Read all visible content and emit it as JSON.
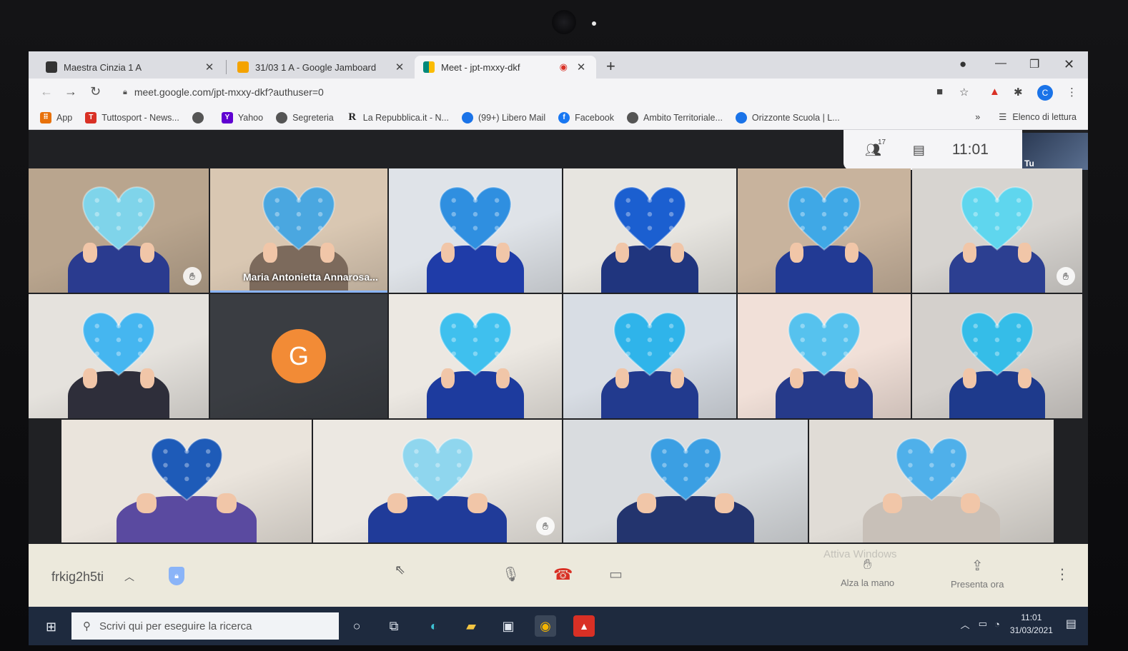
{
  "browser": {
    "tabs": [
      {
        "title": "Maestra Cinzia 1 A",
        "favicon_color": "#333333"
      },
      {
        "title": "31/03 1 A - Google Jamboard",
        "favicon_color": "#f4a300"
      },
      {
        "title": "Meet - jpt-mxxy-dkf",
        "favicon_color": "#00897b"
      }
    ],
    "new_tab": "+",
    "url": "meet.google.com/jpt-mxxy-dkf?authuser=0",
    "profile_initial": "C",
    "bookmarks": [
      {
        "label": "App",
        "icon": "apps-grid-icon",
        "color": "#e8710a"
      },
      {
        "label": "Tuttosport - News...",
        "icon": "T",
        "color": "#d93025"
      },
      {
        "label": "",
        "icon": "globe-icon",
        "color": "#555555"
      },
      {
        "label": "Yahoo",
        "icon": "Y!",
        "color": "#5f01d1"
      },
      {
        "label": "Segreteria",
        "icon": "globe-icon",
        "color": "#555555"
      },
      {
        "label": "La Repubblica.it - N...",
        "icon": "R",
        "color": "#222222"
      },
      {
        "label": "(99+) Libero Mail",
        "icon": "libero-icon",
        "color": "#1a73e8"
      },
      {
        "label": "Facebook",
        "icon": "f",
        "color": "#1877f2"
      },
      {
        "label": "Ambito Territoriale...",
        "icon": "globe-icon",
        "color": "#555555"
      },
      {
        "label": "Orizzonte Scuola | L...",
        "icon": "globe-icon",
        "color": "#1a73e8"
      }
    ],
    "bookmarks_overflow": "»",
    "reading_list": "Elenco di lettura"
  },
  "meet": {
    "people_count": "17",
    "clock": "11:01",
    "self_label": "Tu",
    "tiles": [
      {
        "bg": "#b9a58e",
        "shirt": "#2a3b8f",
        "heart": "#7fd4ea",
        "raise": true,
        "name": ""
      },
      {
        "bg": "#d9c7b2",
        "shirt": "#7c6a5c",
        "heart": "#4aa7e0",
        "raise": false,
        "name": "Maria Antonietta Annarosa...",
        "active": true
      },
      {
        "bg": "#dfe3e8",
        "shirt": "#1f3ca8",
        "heart": "#2f8fe0",
        "raise": false,
        "name": ""
      },
      {
        "bg": "#e7e5e0",
        "shirt": "#20357e",
        "heart": "#1b5fd0",
        "raise": false,
        "name": ""
      },
      {
        "bg": "#c8b39d",
        "shirt": "#223a94",
        "heart": "#3fa8e6",
        "raise": false,
        "name": ""
      },
      {
        "bg": "#d7d4d0",
        "shirt": "#2c3f91",
        "heart": "#5fd6ee",
        "raise": true,
        "name": ""
      },
      {
        "bg": "#e5e2dd",
        "shirt": "#2e2e3a",
        "heart": "#45b6f0",
        "raise": false,
        "name": ""
      },
      {
        "bg": "#3a3d42",
        "avatar": "G",
        "raise": false,
        "name": ""
      },
      {
        "bg": "#ece8e2",
        "shirt": "#1d3b9e",
        "heart": "#3fc0ee",
        "raise": false,
        "name": ""
      },
      {
        "bg": "#d8dde4",
        "shirt": "#223a8e",
        "heart": "#2fb4ea",
        "raise": false,
        "name": ""
      },
      {
        "bg": "#f1e0d8",
        "shirt": "#263a8a",
        "heart": "#56c2ee",
        "raise": false,
        "name": ""
      },
      {
        "bg": "#d4d0cc",
        "shirt": "#1e3a8c",
        "heart": "#35bde8",
        "raise": false,
        "name": ""
      },
      {
        "bg": "#eae4dc",
        "shirt": "#5a4aa0",
        "heart": "#1e5bb8",
        "raise": false,
        "name": ""
      },
      {
        "bg": "#ece8e2",
        "shirt": "#203b99",
        "heart": "#8fd6ee",
        "raise": true,
        "name": ""
      },
      {
        "bg": "#d9dcdf",
        "shirt": "#23346e",
        "heart": "#3b9fe3",
        "raise": false,
        "name": ""
      },
      {
        "bg": "#e0dcd6",
        "shirt": "#c8c0b8",
        "heart": "#4fb0ea",
        "raise": false,
        "name": ""
      }
    ],
    "bar": {
      "meeting_code": "frkig2h5ti",
      "raise_hand_label": "Alza la mano",
      "present_label": "Presenta ora",
      "watermark": "Attiva Windows"
    }
  },
  "taskbar": {
    "search_placeholder": "Scrivi qui per eseguire la ricerca",
    "time": "11:01",
    "date": "31/03/2021",
    "apps": [
      "cortana-icon",
      "task-view-icon",
      "edge-icon",
      "file-explorer-icon",
      "store-icon",
      "chrome-icon",
      "acrobat-icon"
    ]
  }
}
